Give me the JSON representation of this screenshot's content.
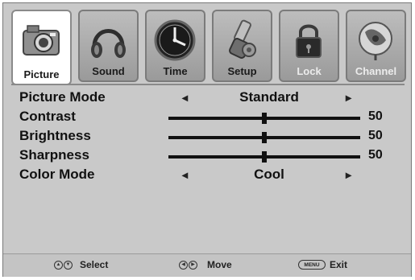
{
  "tabs": [
    {
      "label": "Picture",
      "icon": "camera-icon",
      "active": true
    },
    {
      "label": "Sound",
      "icon": "headphones-icon"
    },
    {
      "label": "Time",
      "icon": "clock-icon"
    },
    {
      "label": "Setup",
      "icon": "tools-icon"
    },
    {
      "label": "Lock",
      "icon": "lock-icon",
      "dim": true
    },
    {
      "label": "Channel",
      "icon": "satellite-dish-icon",
      "dim": true
    }
  ],
  "settings": {
    "picture_mode": {
      "label": "Picture Mode",
      "value": "Standard",
      "left_arrow": "◂",
      "right_arrow": "▸"
    },
    "contrast": {
      "label": "Contrast",
      "value": "50",
      "level": 0.5
    },
    "brightness": {
      "label": "Brightness",
      "value": "50",
      "level": 0.5
    },
    "sharpness": {
      "label": "Sharpness",
      "value": "50",
      "level": 0.5
    },
    "color_mode": {
      "label": "Color Mode",
      "value": "Cool",
      "left_arrow": "◂",
      "right_arrow": "▸"
    }
  },
  "footer": {
    "select_label": "Select",
    "move_label": "Move",
    "menu_key": "MENU",
    "exit_label": "Exit",
    "up_glyph": "▲",
    "down_glyph": "▼",
    "left_glyph": "◀",
    "right_glyph": "▶"
  }
}
